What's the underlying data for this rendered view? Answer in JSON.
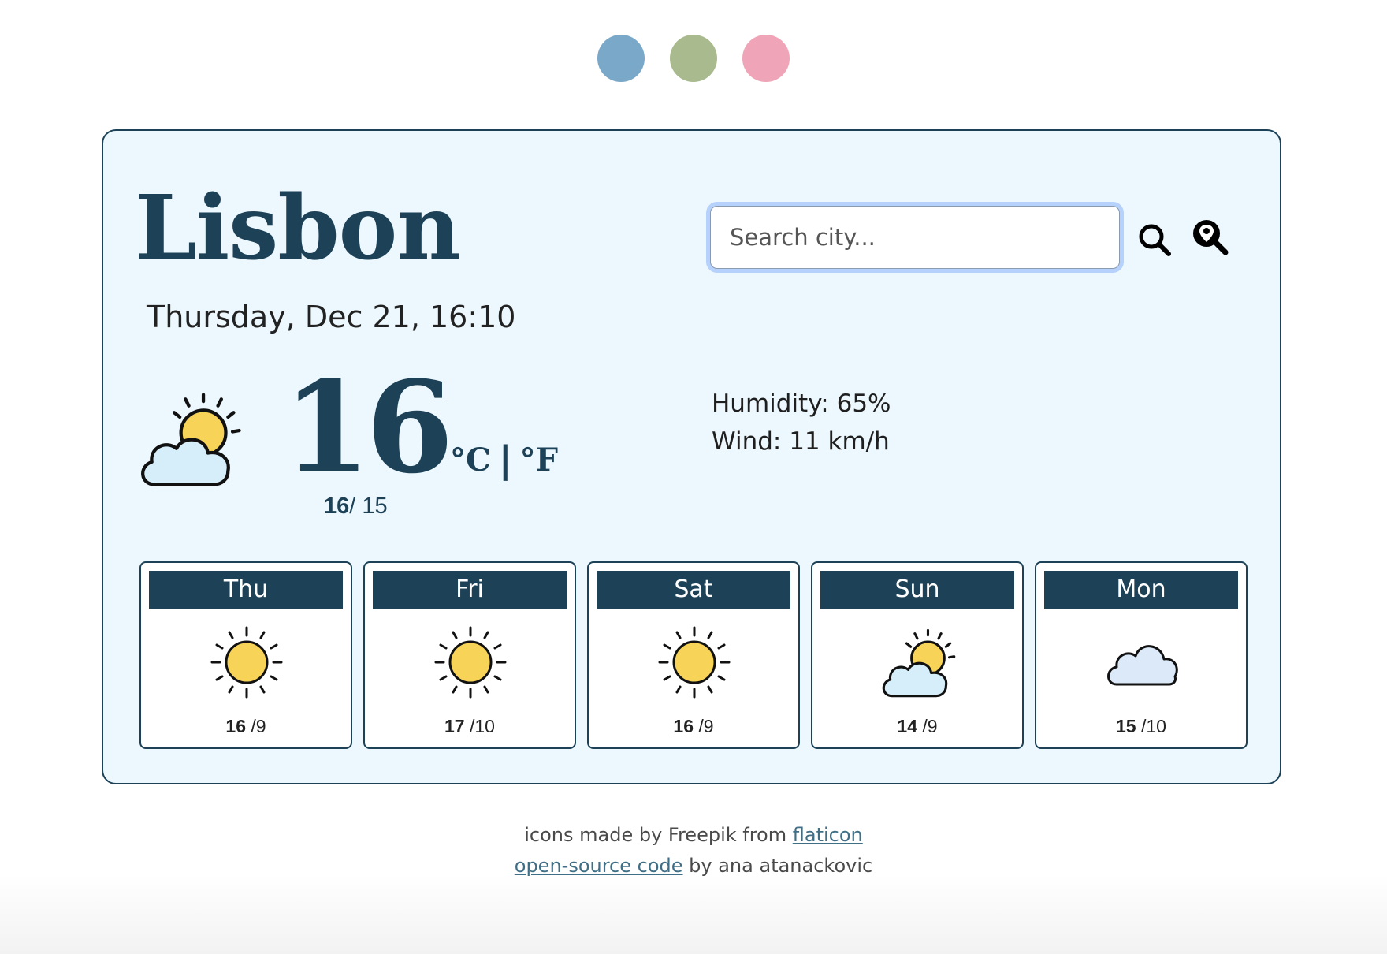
{
  "theme": {
    "colors": [
      "#79a8c8",
      "#a8ba8e",
      "#efa5b7"
    ]
  },
  "weather": {
    "city": "Lisbon",
    "datetime": "Thursday, Dec 21, 16:10",
    "icon": "partly-cloudy-icon",
    "temperature": "16",
    "unit_c": "°C",
    "unit_sep": "|",
    "unit_f": "°F",
    "max": "16",
    "min": "/ 15",
    "humidity": "Humidity: 65%",
    "wind": "Wind: 11 km/h"
  },
  "search": {
    "placeholder": "Search city..."
  },
  "forecast": [
    {
      "day": "Thu",
      "icon": "sun-icon",
      "max": "16",
      "min": " /9"
    },
    {
      "day": "Fri",
      "icon": "sun-icon",
      "max": "17",
      "min": " /10"
    },
    {
      "day": "Sat",
      "icon": "sun-icon",
      "max": "16",
      "min": " /9"
    },
    {
      "day": "Sun",
      "icon": "partly-cloudy-icon",
      "max": "14",
      "min": " /9"
    },
    {
      "day": "Mon",
      "icon": "cloud-icon",
      "max": "15",
      "min": " /10"
    }
  ],
  "footer": {
    "line1_text": "icons made by Freepik from ",
    "line1_link": "flaticon",
    "line2_link": "open-source code",
    "line2_text": " by ana atanackovic"
  },
  "colors": {
    "accent": "#1d4157",
    "card_bg": "#ecf8fd",
    "sun": "#f7d358",
    "cloud": "#d6eef9"
  }
}
